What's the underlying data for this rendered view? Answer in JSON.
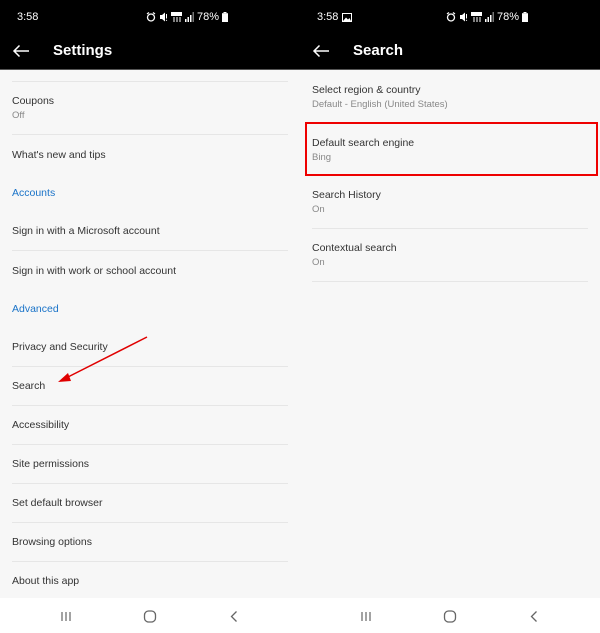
{
  "status_bar": {
    "time": "3:58",
    "battery": "78%",
    "icons": [
      "alarm-icon",
      "mute-icon",
      "lte-icon",
      "signal-icon",
      "battery-icon"
    ]
  },
  "left_screen": {
    "title": "Settings",
    "items": [
      {
        "type": "item",
        "label": "Coupons",
        "sub": "Off"
      },
      {
        "type": "item",
        "label": "What's new and tips"
      },
      {
        "type": "header",
        "label": "Accounts"
      },
      {
        "type": "item",
        "label": "Sign in with a Microsoft account"
      },
      {
        "type": "item",
        "label": "Sign in with work or school account"
      },
      {
        "type": "header",
        "label": "Advanced"
      },
      {
        "type": "item",
        "label": "Privacy and Security"
      },
      {
        "type": "item",
        "label": "Search"
      },
      {
        "type": "item",
        "label": "Accessibility"
      },
      {
        "type": "item",
        "label": "Site permissions"
      },
      {
        "type": "item",
        "label": "Set default browser"
      },
      {
        "type": "item",
        "label": "Browsing options"
      },
      {
        "type": "item",
        "label": "About this app"
      }
    ]
  },
  "right_screen": {
    "title": "Search",
    "items": [
      {
        "label": "Select region & country",
        "sub": "Default - English (United States)"
      },
      {
        "label": "Default search engine",
        "sub": "Bing"
      },
      {
        "label": "Search History",
        "sub": "On"
      },
      {
        "label": "Contextual search",
        "sub": "On"
      }
    ]
  },
  "annotations": {
    "arrow_target": "Search",
    "highlight_target": "Default search engine",
    "color": "#e00000"
  },
  "navbar": {
    "buttons": [
      "recent-apps",
      "home",
      "back"
    ]
  }
}
